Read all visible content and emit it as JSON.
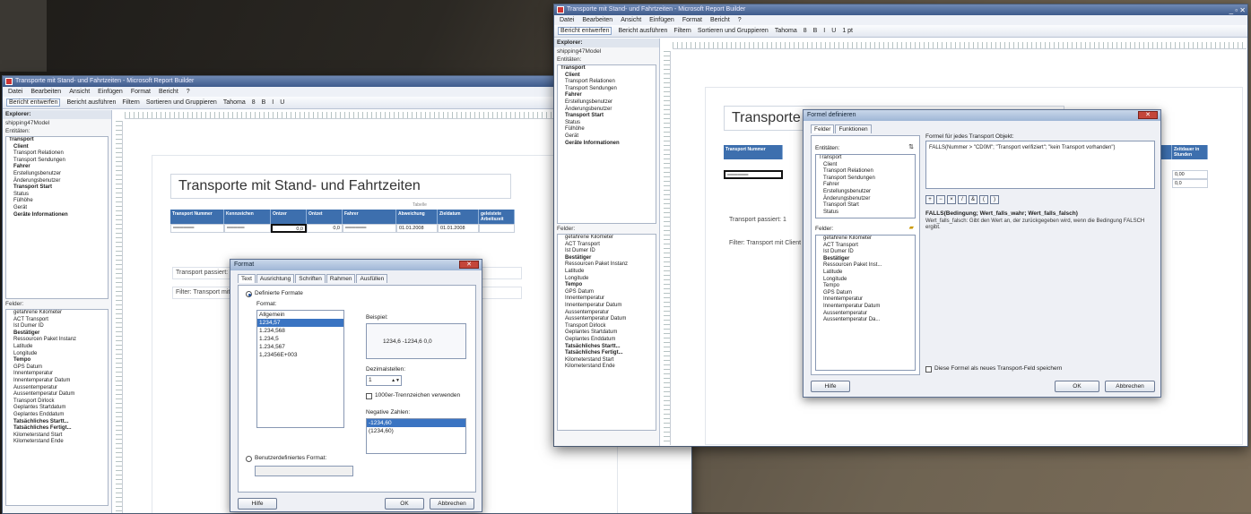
{
  "windows": {
    "win1": {
      "title": "Transporte mit Stand- und Fahrtzeiten - Microsoft Report Builder",
      "menu": [
        "Datei",
        "Bearbeiten",
        "Ansicht",
        "Einfügen",
        "Format",
        "Bericht",
        "?"
      ],
      "toolbar": [
        "Bericht entwerfen",
        "Bericht ausführen",
        "Filtern",
        "Sortieren und Gruppieren",
        "Tahoma",
        "8",
        "B",
        "I",
        "U"
      ],
      "explorer_label": "Explorer:",
      "model": "shipping47Model",
      "entities_label": "Entitäten:",
      "entities": [
        {
          "t": "Transport",
          "c": "b"
        },
        {
          "t": "Client",
          "c": "i1 b"
        },
        {
          "t": "Transport Relationen",
          "c": "i1"
        },
        {
          "t": "Transport Sendungen",
          "c": "i1"
        },
        {
          "t": "Fahrer",
          "c": "i1 b"
        },
        {
          "t": "Erstellungsbenutzer",
          "c": "i1"
        },
        {
          "t": "Änderungsbenutzer",
          "c": "i1"
        },
        {
          "t": "Transport Start",
          "c": "i1 b"
        },
        {
          "t": "Status",
          "c": "i1"
        },
        {
          "t": "Fülhöhe",
          "c": "i1"
        },
        {
          "t": "Gerät",
          "c": "i1"
        },
        {
          "t": "Geräte Informationen",
          "c": "i1 b"
        }
      ],
      "fields_label": "Felder:",
      "fields": [
        {
          "t": "gefahrene Kilometer",
          "c": "i1"
        },
        {
          "t": "ACT Transport",
          "c": "i1"
        },
        {
          "t": "Ist Dumer ID",
          "c": "i1"
        },
        {
          "t": "Bestätiger",
          "c": "i1 b"
        },
        {
          "t": "Ressourcen Paket Instanz",
          "c": "i1"
        },
        {
          "t": "Latitude",
          "c": "i1"
        },
        {
          "t": "Longitude",
          "c": "i1"
        },
        {
          "t": "Tempo",
          "c": "i1 b"
        },
        {
          "t": "GPS Datum",
          "c": "i1"
        },
        {
          "t": "Innentemperatur",
          "c": "i1"
        },
        {
          "t": "Innentemperatur Datum",
          "c": "i1"
        },
        {
          "t": "Aussentemperatur",
          "c": "i1"
        },
        {
          "t": "Aussentemperatur Datum",
          "c": "i1"
        },
        {
          "t": "Transport Dirlock",
          "c": "i1"
        },
        {
          "t": "Geplantes Startdatum",
          "c": "i1"
        },
        {
          "t": "Geplantes Enddatum",
          "c": "i1"
        },
        {
          "t": "Tatsächliches Startt...",
          "c": "i1 b"
        },
        {
          "t": "Tatsächliches Fertigt...",
          "c": "i1 b"
        },
        {
          "t": "Kilometerstand Start",
          "c": "i1"
        },
        {
          "t": "Kilometerstand Ende",
          "c": "i1"
        }
      ],
      "report_title": "Transporte mit Stand- und Fahrtzeiten",
      "table_caption": "Tabelle",
      "columns": [
        "Transport Nummer",
        "Kennzeichen",
        "Ontzer",
        "Ontzet",
        "Fahrer",
        "Abweichung",
        "Zieldatum",
        "geleistete Arbeitszeit"
      ],
      "row": [
        "══════",
        "═════",
        "0,0",
        "0,0",
        "══════",
        "01.01.2008",
        "01.01.2008",
        ""
      ],
      "line1": "Transport passiert: 1",
      "line2": "Filter: Transport mit..."
    },
    "dlg1": {
      "title": "Format",
      "tabs": [
        "Text",
        "Ausrichtung",
        "Schriften",
        "Rahmen",
        "Ausfüllen"
      ],
      "radio_fixed": "Definierte Formate",
      "format_label": "Format:",
      "formats": [
        "Allgemein",
        "1234,57",
        "1.234,568",
        "1.234,5",
        "1.234,567",
        "1,23456E+003"
      ],
      "formats_sel": 1,
      "sample_label": "Beispiel:",
      "sample_value": "1234,6   -1234,6   0,0",
      "decimals_label": "Dezimalstellen:",
      "decimals_value": "1",
      "thousands_check": "1000er-Trennzeichen verwenden",
      "negative_label": "Negative Zahlen:",
      "negative_list": [
        "-1234,60",
        "(1234,60)"
      ],
      "radio_custom": "Benutzerdefiniertes Format:",
      "help": "Hilfe",
      "ok": "OK",
      "cancel": "Abbrechen"
    },
    "win2": {
      "title": "Transporte mit Stand- und Fahrtzeiten - Microsoft Report Builder",
      "menu": [
        "Datei",
        "Bearbeiten",
        "Ansicht",
        "Einfügen",
        "Format",
        "Bericht",
        "?"
      ],
      "toolbar": [
        "Bericht entwerfen",
        "Bericht ausführen",
        "Filtern",
        "Sortieren und Gruppieren",
        "Tahoma",
        "8",
        "B",
        "I",
        "U",
        "1 pt"
      ],
      "explorer_label": "Explorer:",
      "model": "shipping47Model",
      "entities_label": "Entitäten:",
      "entities": [
        {
          "t": "Transport",
          "c": "b"
        },
        {
          "t": "Client",
          "c": "i1 b"
        },
        {
          "t": "Transport Relationen",
          "c": "i1"
        },
        {
          "t": "Transport Sendungen",
          "c": "i1"
        },
        {
          "t": "Fahrer",
          "c": "i1 b"
        },
        {
          "t": "Erstellungsbenutzer",
          "c": "i1"
        },
        {
          "t": "Änderungsbenutzer",
          "c": "i1"
        },
        {
          "t": "Transport Start",
          "c": "i1 b"
        },
        {
          "t": "Status",
          "c": "i1"
        },
        {
          "t": "Fülhöhe",
          "c": "i1"
        },
        {
          "t": "Gerät",
          "c": "i1"
        },
        {
          "t": "Geräte Informationen",
          "c": "i1 b"
        }
      ],
      "fields_label": "Felder:",
      "fields": [
        {
          "t": "gefahrene Kilometer",
          "c": "i1"
        },
        {
          "t": "ACT Transport",
          "c": "i1"
        },
        {
          "t": "Ist Dumer ID",
          "c": "i1"
        },
        {
          "t": "Bestätiger",
          "c": "i1 b"
        },
        {
          "t": "Ressourcen Paket Instanz",
          "c": "i1"
        },
        {
          "t": "Latitude",
          "c": "i1"
        },
        {
          "t": "Longitude",
          "c": "i1"
        },
        {
          "t": "Tempo",
          "c": "i1 b"
        },
        {
          "t": "GPS Datum",
          "c": "i1"
        },
        {
          "t": "Innentemperatur",
          "c": "i1"
        },
        {
          "t": "Innentemperatur Datum",
          "c": "i1"
        },
        {
          "t": "Aussentemperatur",
          "c": "i1"
        },
        {
          "t": "Aussentemperatur Datum",
          "c": "i1"
        },
        {
          "t": "Transport Dirlock",
          "c": "i1"
        },
        {
          "t": "Geplantes Startdatum",
          "c": "i1"
        },
        {
          "t": "Geplantes Enddatum",
          "c": "i1"
        },
        {
          "t": "Tatsächliches Startt...",
          "c": "i1 b"
        },
        {
          "t": "Tatsächliches Fertigt...",
          "c": "i1 b"
        },
        {
          "t": "Kilometerstand Start",
          "c": "i1"
        },
        {
          "t": "Kilometerstand Ende",
          "c": "i1"
        }
      ],
      "report_title": "Transporte mit Stand- und Fahrtzeiten",
      "col_first": "Transport Nummer",
      "col_last": [
        "Dauer in Stunden",
        "Zeitdauer in Stunden"
      ],
      "row_last": [
        "0,00",
        "0,0"
      ],
      "line1": "Transport passiert: 1",
      "line2": "Filter: Transport mit Client"
    },
    "dlg2": {
      "title": "Formel definieren",
      "tabs": [
        "Felder",
        "Funktionen"
      ],
      "entities_label": "Entitäten:",
      "entities": [
        {
          "t": "Transport",
          "c": ""
        },
        {
          "t": "Client",
          "c": "i1"
        },
        {
          "t": "Transport Relationen",
          "c": "i1"
        },
        {
          "t": "Transport Sendungen",
          "c": "i1"
        },
        {
          "t": "Fahrer",
          "c": "i1"
        },
        {
          "t": "Erstellungsbenutzer",
          "c": "i1"
        },
        {
          "t": "Änderungsbenutzer",
          "c": "i1"
        },
        {
          "t": "Transport Start",
          "c": "i1"
        },
        {
          "t": "Status",
          "c": "i1"
        }
      ],
      "fields_label": "Felder:",
      "fields": [
        {
          "t": "gefahrene Kilometer",
          "c": "i1"
        },
        {
          "t": "ACT Transport",
          "c": "i1"
        },
        {
          "t": "Ist Dumer ID",
          "c": "i1"
        },
        {
          "t": "Bestätiger",
          "c": "i1 b"
        },
        {
          "t": "Ressourcen Paket Inst...",
          "c": "i1"
        },
        {
          "t": "Latitude",
          "c": "i1"
        },
        {
          "t": "Longitude",
          "c": "i1"
        },
        {
          "t": "Tempo",
          "c": "i1"
        },
        {
          "t": "GPS Datum",
          "c": "i1"
        },
        {
          "t": "Innentemperatur",
          "c": "i1"
        },
        {
          "t": "Innentemperatur Datum",
          "c": "i1"
        },
        {
          "t": "Aussentemperatur",
          "c": "i1"
        },
        {
          "t": "Aussentemperatur Da...",
          "c": "i1"
        }
      ],
      "formula_label": "Formel für jedes Transport Objekt:",
      "formula": "FALLS(Nummer > \"CD0M\"; \"Transport verifiziert\"; \"kein Transport vorhanden\")",
      "ops": [
        "+",
        "−",
        "×",
        "/",
        "&",
        "(",
        ")"
      ],
      "func_sig": "FALLS(Bedingung; Wert_falls_wahr; Wert_falls_falsch)",
      "func_desc": "Wert_falls_falsch: Gibt den Wert an, der zurückgegeben wird, wenn die Bedingung FALSCH ergibt.",
      "save_check": "Diese Formel als neues Transport-Feld speichern",
      "help": "Hilfe",
      "ok": "OK",
      "cancel": "Abbrechen"
    }
  }
}
